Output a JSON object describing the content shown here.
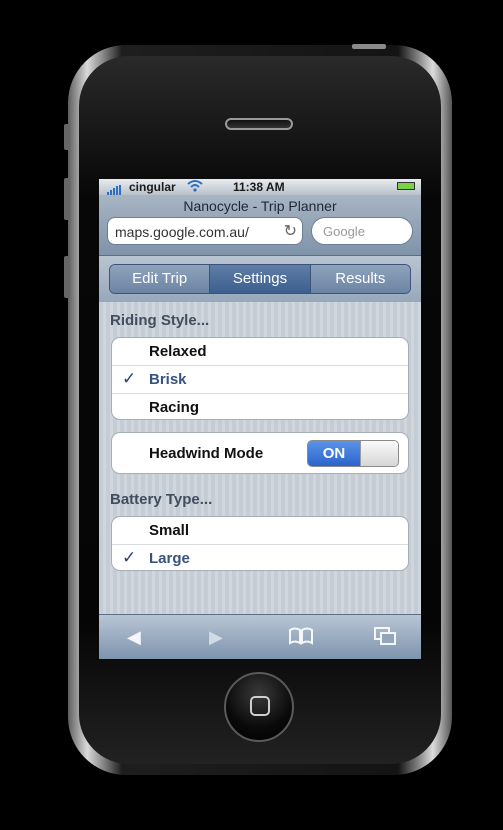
{
  "status_bar": {
    "carrier": "cingular",
    "time": "11:38 AM",
    "wifi_icon": "wifi-icon",
    "battery_icon": "battery-icon"
  },
  "browser": {
    "page_title": "Nanocycle - Trip Planner",
    "url": "maps.google.com.au/",
    "search_placeholder": "Google"
  },
  "tabs": [
    {
      "label": "Edit Trip",
      "selected": false
    },
    {
      "label": "Settings",
      "selected": true
    },
    {
      "label": "Results",
      "selected": false
    }
  ],
  "riding_style": {
    "title": "Riding Style...",
    "options": [
      {
        "label": "Relaxed",
        "checked": false
      },
      {
        "label": "Brisk",
        "checked": true
      },
      {
        "label": "Racing",
        "checked": false
      }
    ]
  },
  "headwind": {
    "label": "Headwind Mode",
    "toggle_label": "ON",
    "state": "on"
  },
  "battery_type": {
    "title": "Battery Type...",
    "options": [
      {
        "label": "Small",
        "checked": false
      },
      {
        "label": "Large",
        "checked": true
      }
    ]
  },
  "checkmark": "✓",
  "toolbar": {
    "back_icon": "back-arrow-icon",
    "forward_icon": "forward-arrow-icon",
    "bookmarks_icon": "bookmarks-icon",
    "pages_icon": "pages-icon"
  },
  "colors": {
    "accent": "#2a64c9",
    "selected_tab": "#3c5f8f"
  }
}
